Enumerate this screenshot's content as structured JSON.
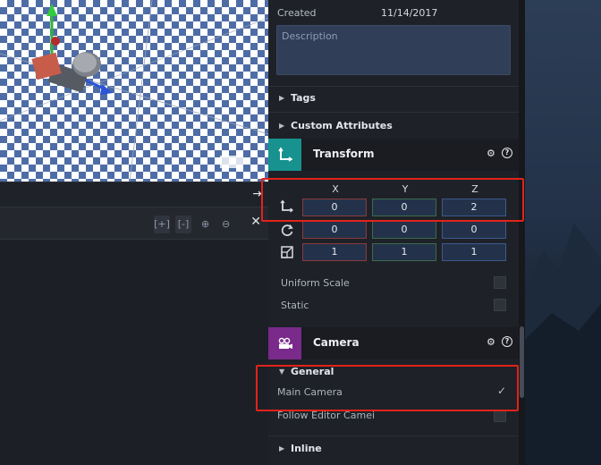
{
  "entity": {
    "created_label": "Created",
    "created_value": "11/14/2017",
    "description_placeholder": "Description"
  },
  "sections": {
    "tags": "Tags",
    "custom_attributes": "Custom Attributes",
    "general": "General",
    "inline": "Inline"
  },
  "transform": {
    "title": "Transform",
    "axes": [
      "X",
      "Y",
      "Z"
    ],
    "position": [
      "0",
      "0",
      "2"
    ],
    "rotation": [
      "0",
      "0",
      "0"
    ],
    "scale": [
      "1",
      "1",
      "1"
    ],
    "uniform_scale_label": "Uniform Scale",
    "static_label": "Static"
  },
  "camera": {
    "title": "Camera",
    "main_camera_label": "Main Camera",
    "main_camera_checked": true,
    "follow_editor_label": "Follow Editor Camei"
  },
  "viewport_toolbar": {
    "buttons": [
      "[+]",
      "[-]",
      "⊕",
      "⊖"
    ]
  },
  "colors": {
    "transform_accent": "#17928f",
    "camera_accent": "#7a2a8a",
    "highlight": "#e2231a"
  }
}
